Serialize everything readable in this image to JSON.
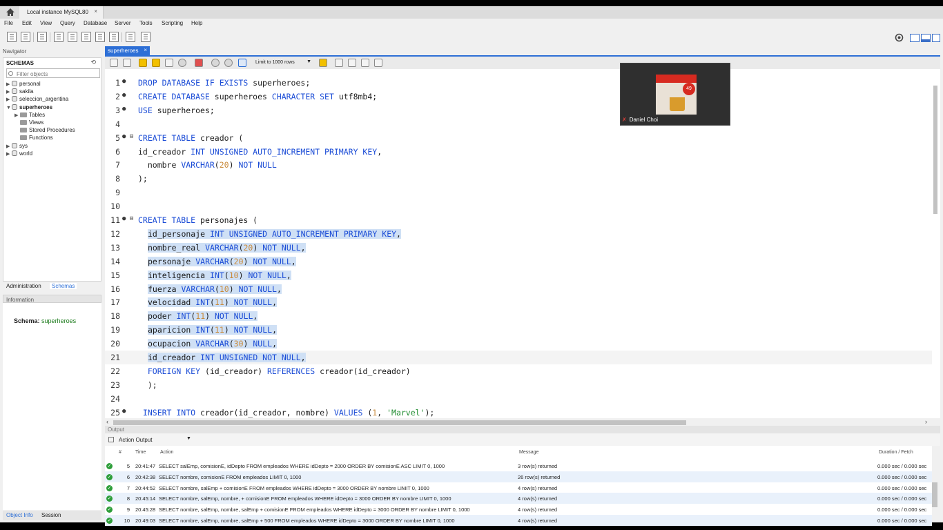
{
  "window": {
    "tab_title": "Local instance MySQL80",
    "close": "×"
  },
  "menu": [
    "File",
    "Edit",
    "View",
    "Query",
    "Database",
    "Server",
    "Tools",
    "Scripting",
    "Help"
  ],
  "navigator": {
    "title": "Navigator",
    "schemas_label": "SCHEMAS",
    "filter_placeholder": "Filter objects",
    "schemas": [
      "personal",
      "sakila",
      "seleccion_argentina",
      "superheroes"
    ],
    "children": [
      "Tables",
      "Views",
      "Stored Procedures",
      "Functions"
    ],
    "more_schemas": [
      "sys",
      "world"
    ],
    "tabs": [
      "Administration",
      "Schemas"
    ],
    "info_title": "Information",
    "schema_label": "Schema:",
    "schema_value": "superheroes",
    "bottom_tabs": [
      "Object Info",
      "Session"
    ]
  },
  "editor": {
    "tab_label": "superheroes",
    "tab_close": "×",
    "limit_label": "Limit to 1000 rows",
    "lines": [
      {
        "n": "1",
        "mark": "●",
        "tokens": [
          [
            "kw",
            "DROP DATABASE IF EXISTS "
          ],
          [
            "",
            "superheroes;"
          ]
        ]
      },
      {
        "n": "2",
        "mark": "●",
        "tokens": [
          [
            "kw",
            "CREATE DATABASE "
          ],
          [
            "",
            "superheroes "
          ],
          [
            "kw",
            "CHARACTER SET "
          ],
          [
            "",
            "utf8mb4;"
          ]
        ]
      },
      {
        "n": "3",
        "mark": "●",
        "tokens": [
          [
            "kw",
            "USE "
          ],
          [
            "",
            "superheroes;"
          ]
        ]
      },
      {
        "n": "4",
        "mark": "",
        "tokens": []
      },
      {
        "n": "5",
        "mark": "● ⊟",
        "tokens": [
          [
            "kw",
            "CREATE TABLE "
          ],
          [
            "",
            "creador ("
          ]
        ]
      },
      {
        "n": "6",
        "mark": "",
        "tokens": [
          [
            "",
            "id_creador "
          ],
          [
            "kw",
            "INT UNSIGNED AUTO_INCREMENT PRIMARY KEY"
          ],
          [
            "",
            ","
          ]
        ]
      },
      {
        "n": "7",
        "mark": "",
        "tokens": [
          [
            "",
            "  nombre "
          ],
          [
            "kw",
            "VARCHAR"
          ],
          [
            "",
            "("
          ],
          [
            "num",
            "20"
          ],
          [
            "",
            ") "
          ],
          [
            "kw",
            "NOT NULL"
          ]
        ]
      },
      {
        "n": "8",
        "mark": "",
        "tokens": [
          [
            "",
            ");"
          ]
        ]
      },
      {
        "n": "9",
        "mark": "",
        "tokens": []
      },
      {
        "n": "10",
        "mark": "",
        "tokens": []
      },
      {
        "n": "11",
        "mark": "● ⊟",
        "tokens": [
          [
            "kw",
            "CREATE TABLE "
          ],
          [
            "",
            "personajes ("
          ]
        ]
      },
      {
        "n": "12",
        "mark": "",
        "sel": true,
        "tokens": [
          [
            "",
            "id_personaje "
          ],
          [
            "kw",
            "INT UNSIGNED AUTO_INCREMENT PRIMARY KEY"
          ],
          [
            "",
            ","
          ]
        ]
      },
      {
        "n": "13",
        "mark": "",
        "sel": true,
        "tokens": [
          [
            "",
            "nombre_real "
          ],
          [
            "kw",
            "VARCHAR"
          ],
          [
            "",
            "("
          ],
          [
            "num",
            "20"
          ],
          [
            "",
            ") "
          ],
          [
            "kw",
            "NOT NULL"
          ],
          [
            "",
            ","
          ]
        ]
      },
      {
        "n": "14",
        "mark": "",
        "sel": true,
        "tokens": [
          [
            "",
            "personaje "
          ],
          [
            "kw",
            "VARCHAR"
          ],
          [
            "",
            "("
          ],
          [
            "num",
            "20"
          ],
          [
            "",
            ") "
          ],
          [
            "kw",
            "NOT NULL"
          ],
          [
            "",
            ","
          ]
        ]
      },
      {
        "n": "15",
        "mark": "",
        "sel": true,
        "tokens": [
          [
            "",
            "inteligencia "
          ],
          [
            "kw",
            "INT"
          ],
          [
            "",
            "("
          ],
          [
            "num",
            "10"
          ],
          [
            "",
            ") "
          ],
          [
            "kw",
            "NOT NULL"
          ],
          [
            "",
            ","
          ]
        ]
      },
      {
        "n": "16",
        "mark": "",
        "sel": true,
        "tokens": [
          [
            "",
            "fuerza "
          ],
          [
            "kw",
            "VARCHAR"
          ],
          [
            "",
            "("
          ],
          [
            "num",
            "10"
          ],
          [
            "",
            ") "
          ],
          [
            "kw",
            "NOT NULL"
          ],
          [
            "",
            ","
          ]
        ]
      },
      {
        "n": "17",
        "mark": "",
        "sel": true,
        "tokens": [
          [
            "",
            "velocidad "
          ],
          [
            "kw",
            "INT"
          ],
          [
            "",
            "("
          ],
          [
            "num",
            "11"
          ],
          [
            "",
            ") "
          ],
          [
            "kw",
            "NOT NULL"
          ],
          [
            "",
            ","
          ]
        ]
      },
      {
        "n": "18",
        "mark": "",
        "sel": true,
        "tokens": [
          [
            "",
            "poder "
          ],
          [
            "kw",
            "INT"
          ],
          [
            "",
            "("
          ],
          [
            "num",
            "11"
          ],
          [
            "",
            ") "
          ],
          [
            "kw",
            "NOT NULL"
          ],
          [
            "",
            ","
          ]
        ]
      },
      {
        "n": "19",
        "mark": "",
        "sel": true,
        "tokens": [
          [
            "",
            "aparicion "
          ],
          [
            "kw",
            "INT"
          ],
          [
            "",
            "("
          ],
          [
            "num",
            "11"
          ],
          [
            "",
            ") "
          ],
          [
            "kw",
            "NOT NULL"
          ],
          [
            "",
            ","
          ]
        ]
      },
      {
        "n": "20",
        "mark": "",
        "sel": true,
        "tokens": [
          [
            "",
            "ocupacion "
          ],
          [
            "kw",
            "VARCHAR"
          ],
          [
            "",
            "("
          ],
          [
            "num",
            "30"
          ],
          [
            "",
            ") "
          ],
          [
            "kw",
            "NULL"
          ],
          [
            "",
            ","
          ]
        ]
      },
      {
        "n": "21",
        "mark": "",
        "sel": true,
        "current": true,
        "tokens": [
          [
            "",
            "id_creador "
          ],
          [
            "kw",
            "INT UNSIGNED NOT NULL"
          ],
          [
            "",
            ","
          ]
        ]
      },
      {
        "n": "22",
        "mark": "",
        "tokens": [
          [
            "",
            "  "
          ],
          [
            "kw",
            "FOREIGN KEY "
          ],
          [
            "",
            "(id_creador) "
          ],
          [
            "kw",
            "REFERENCES "
          ],
          [
            "",
            "creador(id_creador)"
          ]
        ]
      },
      {
        "n": "23",
        "mark": "",
        "tokens": [
          [
            "",
            "  );"
          ]
        ]
      },
      {
        "n": "24",
        "mark": "",
        "tokens": []
      },
      {
        "n": "25",
        "mark": "●",
        "tokens": [
          [
            "kw",
            " INSERT INTO "
          ],
          [
            "",
            "creador(id_creador, nombre) "
          ],
          [
            "kw",
            "VALUES "
          ],
          [
            "",
            "("
          ],
          [
            "num",
            "1"
          ],
          [
            "",
            ", "
          ],
          [
            "str",
            "'Marvel'"
          ],
          [
            "",
            ");"
          ]
        ]
      }
    ]
  },
  "video": {
    "name": "Daniel Choi",
    "mic_icon": "muted-mic-icon",
    "badge": "49"
  },
  "output": {
    "title": "Output",
    "selector": "Action Output",
    "headers": [
      "#",
      "Time",
      "Action",
      "Message",
      "Duration / Fetch"
    ],
    "rows": [
      {
        "n": "5",
        "time": "20:41:47",
        "action": "SELECT salEmp, comisionE, idDepto FROM empleados WHERE idDepto = 2000 ORDER BY comisionE ASC LIMIT 0, 1000",
        "message": "3 row(s) returned",
        "duration": "0.000 sec / 0.000 sec"
      },
      {
        "n": "6",
        "time": "20:42:38",
        "action": "SELECT nombre, comisionE FROM empleados LIMIT 0, 1000",
        "message": "26 row(s) returned",
        "duration": "0.000 sec / 0.000 sec"
      },
      {
        "n": "7",
        "time": "20:44:52",
        "action": "SELECT nombre, salEmp + comisionE FROM empleados WHERE idDepto = 3000 ORDER BY nombre LIMIT 0, 1000",
        "message": "4 row(s) returned",
        "duration": "0.000 sec / 0.000 sec"
      },
      {
        "n": "8",
        "time": "20:45:14",
        "action": "SELECT nombre, salEmp, nombre, + comisionE FROM empleados WHERE idDepto = 3000 ORDER BY nombre LIMIT 0, 1000",
        "message": "4 row(s) returned",
        "duration": "0.000 sec / 0.000 sec"
      },
      {
        "n": "9",
        "time": "20:45:28",
        "action": "SELECT nombre, salEmp, nombre, salEmp + comisionE FROM empleados WHERE idDepto = 3000 ORDER BY nombre LIMIT 0, 1000",
        "message": "4 row(s) returned",
        "duration": "0.000 sec / 0.000 sec"
      },
      {
        "n": "10",
        "time": "20:49:03",
        "action": "SELECT nombre, salEmp, nombre, salEmp + 500 FROM empleados WHERE idDepto = 3000 ORDER BY nombre LIMIT 0, 1000",
        "message": "4 row(s) returned",
        "duration": "0.000 sec / 0.000 sec"
      }
    ]
  },
  "colors": {
    "accent": "#2d6fd6",
    "keyword": "#1b4cd6",
    "number": "#c98a3a",
    "string": "#1f8c2f",
    "selection": "#cfe0f5"
  }
}
